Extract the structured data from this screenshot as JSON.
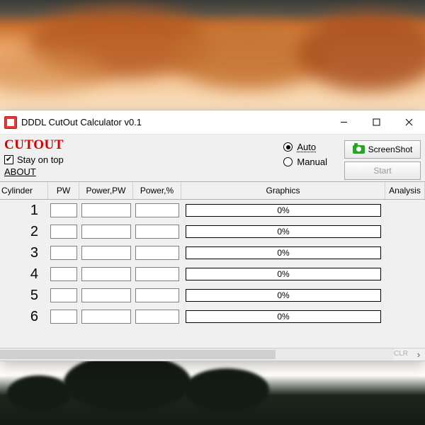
{
  "window": {
    "title": "DDDL CutOut Calculator v0.1"
  },
  "toolbar": {
    "cutout_label": "CUTOUT",
    "stay_on_top_label": "Stay on top",
    "stay_on_top_checked": true,
    "about_label": "ABOUT",
    "mode_auto_label": "Auto",
    "mode_manual_label": "Manual",
    "mode_selected": "auto",
    "screenshot_label": "ScreenShot",
    "start_label": "Start"
  },
  "table": {
    "headers": {
      "cylinder": "Cylinder",
      "pw": "PW",
      "power_pw": "Power,PW",
      "power_pct": "Power,%",
      "graphics": "Graphics",
      "analysis": "Analysis"
    },
    "rows": [
      {
        "cyl": "1",
        "pw": "",
        "power_pw": "",
        "power_pct": "",
        "graphics_pct": "0%"
      },
      {
        "cyl": "2",
        "pw": "",
        "power_pw": "",
        "power_pct": "",
        "graphics_pct": "0%"
      },
      {
        "cyl": "3",
        "pw": "",
        "power_pw": "",
        "power_pct": "",
        "graphics_pct": "0%"
      },
      {
        "cyl": "4",
        "pw": "",
        "power_pw": "",
        "power_pct": "",
        "graphics_pct": "0%"
      },
      {
        "cyl": "5",
        "pw": "",
        "power_pw": "",
        "power_pct": "",
        "graphics_pct": "0%"
      },
      {
        "cyl": "6",
        "pw": "",
        "power_pw": "",
        "power_pct": "",
        "graphics_pct": "0%"
      }
    ]
  },
  "statusbar": {
    "clr_label": "CLR"
  }
}
